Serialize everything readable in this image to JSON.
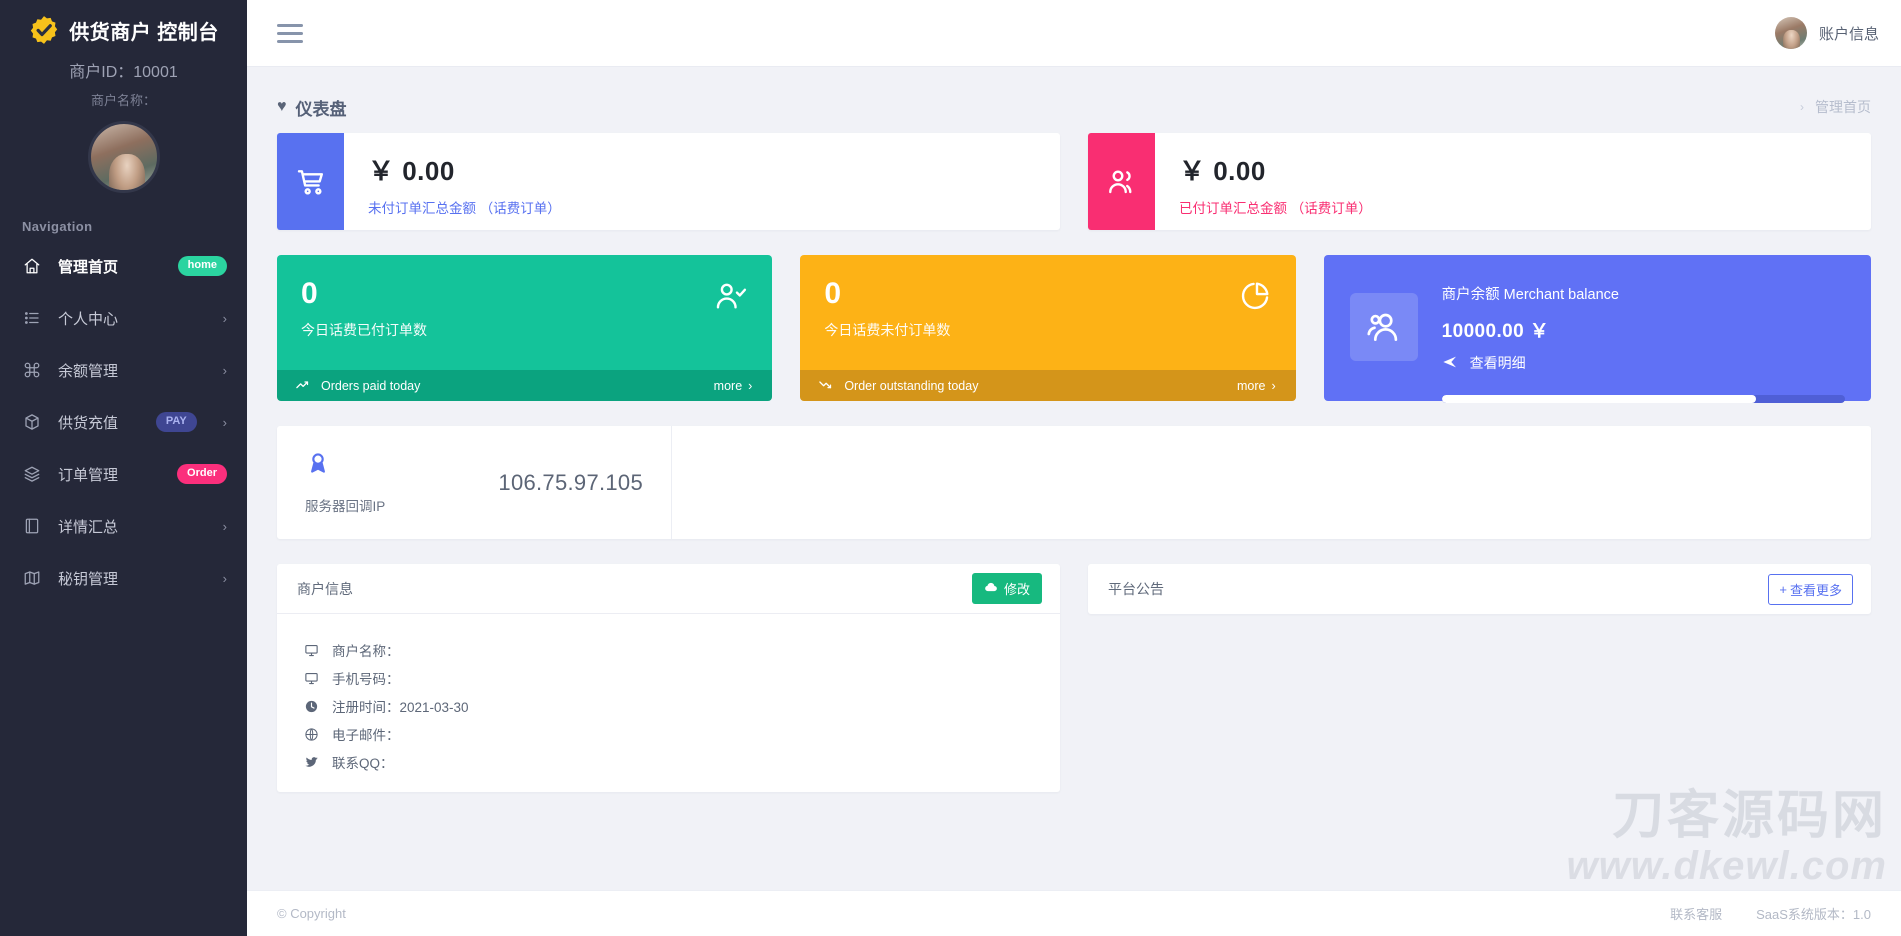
{
  "sidebar": {
    "brand_title": "供货商户 控制台",
    "brand_logo_icon": "check-badge-icon",
    "merchant_id": "商户ID：10001",
    "merchant_name": "商户名称：",
    "nav_heading": "Navigation",
    "items": [
      {
        "label": "管理首页",
        "icon": "home-icon",
        "badge": "home",
        "badge_kind": "home",
        "chevron": ""
      },
      {
        "label": "个人中心",
        "icon": "list-icon",
        "badge": "",
        "badge_kind": "",
        "chevron": "›"
      },
      {
        "label": "余额管理",
        "icon": "command-icon",
        "badge": "",
        "badge_kind": "",
        "chevron": "›"
      },
      {
        "label": "供货充值",
        "icon": "box-icon",
        "badge": "PAY",
        "badge_kind": "pay",
        "chevron": "›"
      },
      {
        "label": "订单管理",
        "icon": "layers-icon",
        "badge": "Order",
        "badge_kind": "order",
        "chevron": ""
      },
      {
        "label": "详情汇总",
        "icon": "book-icon",
        "badge": "",
        "badge_kind": "",
        "chevron": "›"
      },
      {
        "label": "秘钥管理",
        "icon": "map-icon",
        "badge": "",
        "badge_kind": "",
        "chevron": "›"
      }
    ]
  },
  "topbar": {
    "menu_icon": "hamburger-icon",
    "account_label": "账户信息",
    "avatar_icon": "user-avatar"
  },
  "page": {
    "title": "仪表盘",
    "title_icon": "heart-icon",
    "breadcrumb_sep": "›",
    "breadcrumb_current": "管理首页"
  },
  "money_cards": [
    {
      "icon": "cart-icon",
      "amount": "￥ 0.00",
      "label": "未付订单汇总金额 （话费订单）",
      "color": "#5871f0"
    },
    {
      "icon": "users-icon",
      "amount": "￥ 0.00",
      "label": "已付订单汇总金额 （话费订单）",
      "color": "#f92e72"
    }
  ],
  "stat_cards": [
    {
      "number": "0",
      "label": "今日话费已付订单数",
      "icon": "user-check-icon",
      "foot_icon": "trend-up-icon",
      "foot_label": "Orders paid today",
      "more": "more",
      "more_chevron": "›",
      "color": "#14c39a"
    },
    {
      "number": "0",
      "label": "今日话费未付订单数",
      "icon": "pie-chart-icon",
      "foot_icon": "trend-down-icon",
      "foot_label": "Order outstanding today",
      "more": "more",
      "more_chevron": "›",
      "color": "#fdb216"
    }
  ],
  "balance_card": {
    "icon": "users-group-icon",
    "title": "商户余额 Merchant balance",
    "amount": "10000.00 ￥",
    "link_icon": "send-icon",
    "link_label": "查看明细",
    "progress_percent": 78,
    "color": "#6071f5"
  },
  "ip_card": {
    "icon": "award-icon",
    "label": "服务器回调IP",
    "value": "106.75.97.105"
  },
  "merchant_panel": {
    "title": "商户信息",
    "edit_icon": "cloud-icon",
    "edit_label": "修改",
    "rows": [
      {
        "icon": "monitor-icon",
        "text": "商户名称："
      },
      {
        "icon": "monitor-icon",
        "text": "手机号码："
      },
      {
        "icon": "clock-icon",
        "text": "注册时间：2021-03-30"
      },
      {
        "icon": "globe-icon",
        "text": "电子邮件："
      },
      {
        "icon": "twitter-icon",
        "text": "联系QQ："
      }
    ]
  },
  "notice_panel": {
    "title": "平台公告",
    "more_plus": "+",
    "more_label": "查看更多"
  },
  "footer": {
    "copyright": "© Copyright",
    "support": "联系客服",
    "version": "SaaS系统版本：1.0"
  },
  "watermark": {
    "line1": "刀客源码网",
    "line2": "www.dkewl.com"
  }
}
